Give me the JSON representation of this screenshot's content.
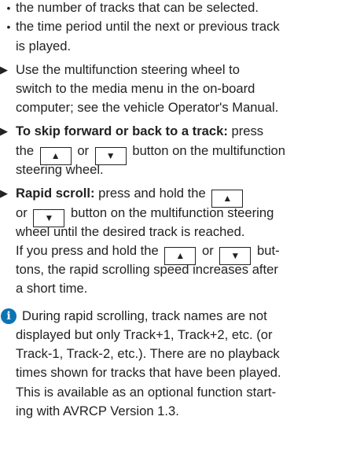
{
  "bullets": [
    "the number of tracks that can be selected.",
    "the time period until the next or previous track",
    "is played."
  ],
  "step1": [
    "Use the multifunction steering wheel to",
    "switch to the media menu in the on-board",
    "computer; see the vehicle Operator's Manual."
  ],
  "step2": {
    "title": "To skip forward or back to a track:",
    "press": "press",
    "the": "the",
    "or": "or",
    "after": "button on the multifunction",
    "line3": "steering wheel."
  },
  "step3": {
    "title": "Rapid scroll:",
    "press_hold": "press and hold the",
    "or": "or",
    "after": "button on the multifunction steering",
    "line3": "wheel until the desired track is reached.",
    "line4a": "If you press and hold the",
    "or2": "or",
    "but": "but-",
    "line5": "tons, the rapid scrolling speed increases after",
    "line6": "a short time."
  },
  "note": [
    "During rapid scrolling, track names are not",
    "displayed but only Track+1, Track+2, etc. (or",
    "Track-1, Track-2, etc.). There are no playback",
    "times shown for tracks that have been played.",
    "This is available as an optional function start-",
    "ing with AVRCP Version 1.3."
  ],
  "icons": {
    "bullet": "•",
    "step_arrow": "▶",
    "key_up": "▲",
    "key_down": "▼",
    "info": "i"
  },
  "colors": {
    "info_icon": "#0b75b4"
  }
}
